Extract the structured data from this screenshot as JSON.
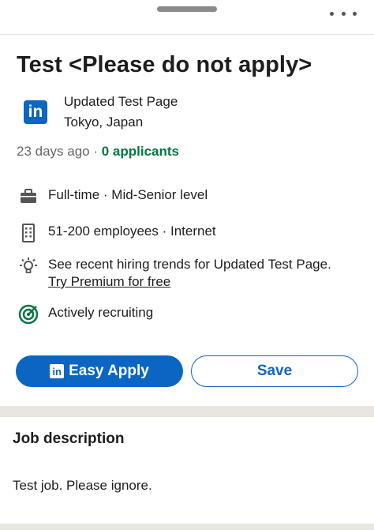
{
  "job": {
    "title": "Test <Please do not apply>",
    "company_name": "Updated Test Page",
    "location": "Tokyo, Japan",
    "posted": "23 days ago",
    "separator": " · ",
    "applicants": "0 applicants"
  },
  "logo": {
    "text": "in",
    "color": "#0a66c2"
  },
  "insights": [
    {
      "icon": "briefcase-icon",
      "text": "Full-time · Mid-Senior level"
    },
    {
      "icon": "building-icon",
      "text": "51-200 employees · Internet"
    },
    {
      "icon": "lightbulb-icon",
      "text": "See recent hiring trends for Updated Test Page.",
      "link": "Try Premium for free"
    },
    {
      "icon": "target-icon",
      "text": "Actively recruiting"
    }
  ],
  "actions": {
    "apply_label": "Easy Apply",
    "apply_icon_text": "in",
    "save_label": "Save"
  },
  "description": {
    "heading": "Job description",
    "body": "Test job. Please ignore."
  },
  "colors": {
    "accent": "#0a66c2",
    "success": "#057642",
    "divider": "#e9e5df"
  }
}
